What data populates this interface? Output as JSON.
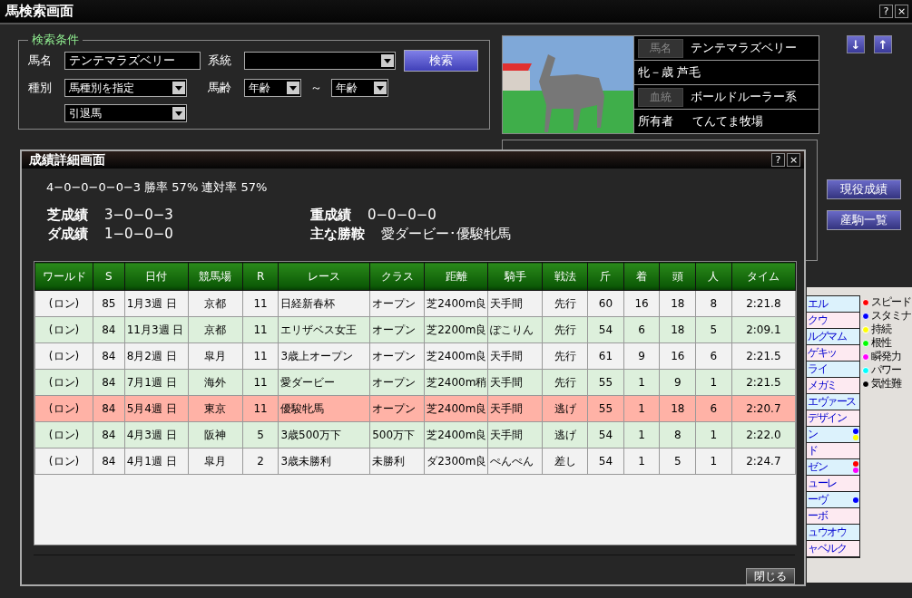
{
  "window": {
    "title": "馬検索画面",
    "help": "?",
    "close": "×"
  },
  "search": {
    "legend": "検索条件",
    "fields": [
      {
        "label": "馬名",
        "value": "テンテマラズベリー"
      },
      {
        "label": "系統"
      },
      {
        "label": "種別",
        "value": "馬種別を指定"
      },
      {
        "label": "馬齢",
        "from": "年齢",
        "sep": "～",
        "to": "年齢"
      }
    ],
    "status_select": "引退馬",
    "button": "検索"
  },
  "horse": {
    "rows": [
      {
        "kind": "tagged",
        "label": "馬名",
        "value": "テンテマラズベリー"
      },
      {
        "kind": "plain",
        "value": "牝－歳 芦毛"
      },
      {
        "kind": "tagged",
        "label": "血統",
        "value": "ボールドルーラー系"
      },
      {
        "kind": "labeled",
        "label": "所有者",
        "value": "てんてま牧場"
      }
    ]
  },
  "nav": {
    "down": "↓",
    "up": "↑"
  },
  "side_buttons": [
    "現役成績",
    "産駒一覧"
  ],
  "list": [
    {
      "name": "エル",
      "color": "#dcf2fc"
    },
    {
      "name": "クウ",
      "color": "#fdeaf1"
    },
    {
      "name": "ルグマム",
      "color": "#dcf2fc"
    },
    {
      "name": "ゲキッ",
      "color": "#fdeaf1"
    },
    {
      "name": "ライ",
      "color": "#dcf2fc"
    },
    {
      "name": "メガミ",
      "color": "#fdeaf1"
    },
    {
      "name": "エヴァース",
      "color": "#dcf2fc"
    },
    {
      "name": "デザイン",
      "color": "#fdeaf1"
    },
    {
      "name": "ン",
      "color": "#dcf2fc",
      "marks": [
        {
          "color": "#0000ff"
        },
        {
          "color": "#ffff00"
        }
      ]
    },
    {
      "name": "ド",
      "color": "#fdeaf1"
    },
    {
      "name": "ゼン",
      "color": "#dcf2fc",
      "marks": [
        {
          "color": "#ff0000"
        },
        {
          "color": "#ff00ff"
        }
      ]
    },
    {
      "name": "ューレ",
      "color": "#fdeaf1"
    },
    {
      "name": "ーヴ",
      "color": "#dcf2fc",
      "marks": [
        {
          "color": "#0000ff"
        }
      ]
    },
    {
      "name": "ーボ",
      "color": "#fdeaf1"
    },
    {
      "name": "ュウオウ",
      "color": "#dcf2fc"
    },
    {
      "name": "ャベルク",
      "color": "#fdeaf1"
    }
  ],
  "legend": [
    {
      "label": "スピード",
      "color": "#ff0000"
    },
    {
      "label": "スタミナ",
      "color": "#0000ff"
    },
    {
      "label": "持続",
      "color": "#ffff00"
    },
    {
      "label": "根性",
      "color": "#00ff00"
    },
    {
      "label": "瞬発力",
      "color": "#ff00ff"
    },
    {
      "label": "パワー",
      "color": "#00ffff"
    },
    {
      "label": "気性難",
      "color": "#000000"
    }
  ],
  "dialog": {
    "title": "成績詳細画面",
    "help": "?",
    "close": "×",
    "summary": "4−0−0−0−0−3 勝率 57% 連対率 57%",
    "stats": [
      {
        "label": "芝成績",
        "value": "3−0−0−3"
      },
      {
        "label": "重成績",
        "value": "0−0−0−0"
      },
      {
        "label": "ダ成績",
        "value": "1−0−0−0"
      },
      {
        "label": "主な勝鞍",
        "value": "愛ダービー･優駿牝馬"
      }
    ],
    "table": {
      "columns": [
        "ワールド",
        "S",
        "日付",
        "競馬場",
        "R",
        "レース",
        "クラス",
        "距離",
        "騎手",
        "戦法",
        "斤",
        "着",
        "頭",
        "人",
        "タイム"
      ],
      "rows": [
        {
          "color": "#f2f2f2",
          "cells": [
            "(ロン)",
            "85",
            "1月3週 日",
            "京都",
            "11",
            "日経新春杯",
            "オープン",
            "芝2400m良",
            "天手間",
            "先行",
            "60",
            "16",
            "18",
            "8",
            "2:21.8"
          ]
        },
        {
          "color": "#ddf0dc",
          "cells": [
            "(ロン)",
            "84",
            "11月3週 日",
            "京都",
            "11",
            "エリザベス女王",
            "オープン",
            "芝2200m良",
            "ぽこりん",
            "先行",
            "54",
            "6",
            "18",
            "5",
            "2:09.1"
          ]
        },
        {
          "color": "#f2f2f2",
          "cells": [
            "(ロン)",
            "84",
            "8月2週 日",
            "皐月",
            "11",
            "3歳上オープン",
            "オープン",
            "芝2400m良",
            "天手間",
            "先行",
            "61",
            "9",
            "16",
            "6",
            "2:21.5"
          ]
        },
        {
          "color": "#ddf0dc",
          "cells": [
            "(ロン)",
            "84",
            "7月1週 日",
            "海外",
            "11",
            "愛ダービー",
            "オープン",
            "芝2400m稍",
            "天手間",
            "先行",
            "55",
            "1",
            "9",
            "1",
            "2:21.5"
          ]
        },
        {
          "color": "#ffb2a6",
          "cells": [
            "(ロン)",
            "84",
            "5月4週 日",
            "東京",
            "11",
            "優駿牝馬",
            "オープン",
            "芝2400m良",
            "天手間",
            "逃げ",
            "55",
            "1",
            "18",
            "6",
            "2:20.7"
          ]
        },
        {
          "color": "#ddf0dc",
          "cells": [
            "(ロン)",
            "84",
            "4月3週 日",
            "阪神",
            "5",
            "3歳500万下",
            "500万下",
            "芝2400m良",
            "天手間",
            "逃げ",
            "54",
            "1",
            "8",
            "1",
            "2:22.0"
          ]
        },
        {
          "color": "#f2f2f2",
          "cells": [
            "(ロン)",
            "84",
            "4月1週 日",
            "皐月",
            "2",
            "3歳未勝利",
            "未勝利",
            "ダ2300m良",
            "ぺんぺん",
            "差し",
            "54",
            "1",
            "5",
            "1",
            "2:24.7"
          ]
        }
      ]
    },
    "close_button": "閉じる"
  }
}
